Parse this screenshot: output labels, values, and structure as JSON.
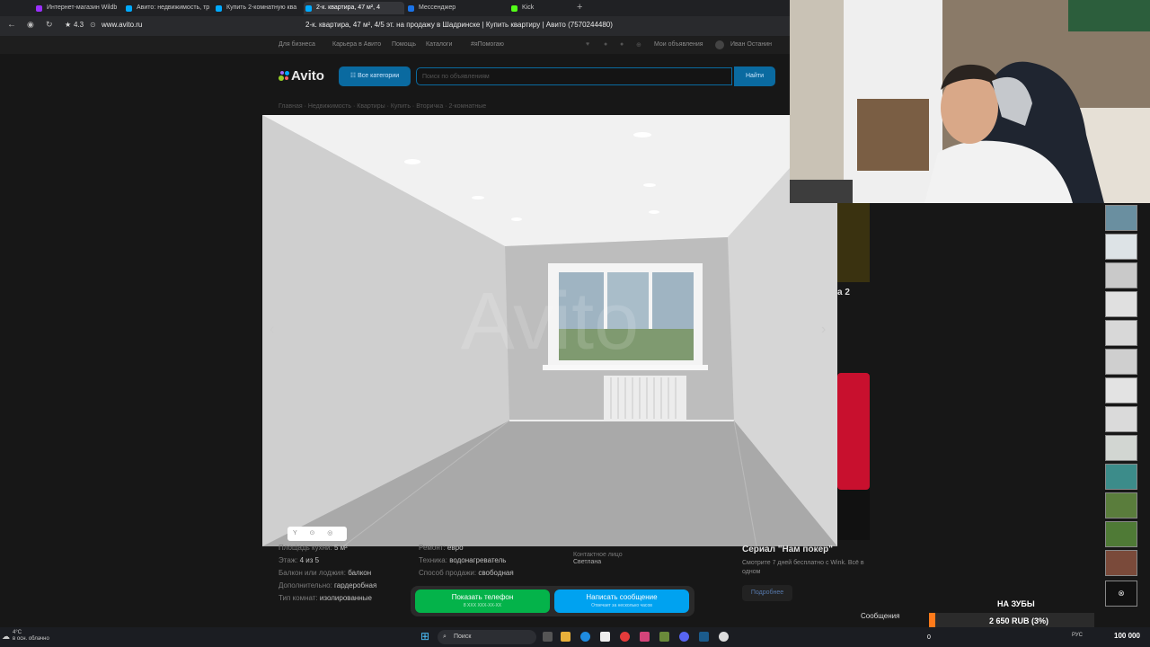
{
  "browser": {
    "tabs": [
      {
        "label": "Интернет-магазин Wildb",
        "color": "#9b30ff"
      },
      {
        "label": "Авито: недвижимость, тр",
        "color": "#00aaff"
      },
      {
        "label": "Купить 2-комнатную ква",
        "color": "#00aaff"
      },
      {
        "label": "2-к. квартира, 47 м², 4",
        "color": "#00aaff",
        "active": true
      },
      {
        "label": "Мессенджер",
        "color": "#1a73e8"
      },
      {
        "label": "Kick",
        "color": "#53fc18"
      }
    ],
    "rating": "4.3",
    "url": "www.avito.ru",
    "page_title": "2-к. квартира, 47 м², 4/5 эт. на продажу в Шадринске | Купить квартиру | Авито (7570244480)"
  },
  "topnav": {
    "links": [
      "Для бизнеса",
      "Карьера в Авито",
      "Помощь",
      "Каталоги",
      "#яПомогаю"
    ],
    "my_ads": "Мои объявления",
    "user": "Иван Останин"
  },
  "header": {
    "logo": "Avito",
    "categories_button": "Все категории",
    "search_placeholder": "Поиск по объявлениям",
    "find_button": "Найти"
  },
  "breadcrumbs": "Главная · Недвижимость · Квартиры · Купить · Вторичка · 2-комнатные",
  "photo": {
    "watermark": "Avito",
    "prev": "‹",
    "next": "›",
    "tools": "Y ⊙ ◎ ⋮"
  },
  "params": {
    "kitchen_label": "Площадь кухни:",
    "kitchen": "5 м²",
    "floor_label": "Этаж:",
    "floor": "4 из 5",
    "balcony_label": "Балкон или лоджия:",
    "balcony": "балкон",
    "extra_label": "Дополнительно:",
    "extra": "гардеробная",
    "rooms_label": "Тип комнат:",
    "rooms": "изолированные",
    "repair_label": "Ремонт:",
    "repair": "евро",
    "appliance_label": "Техника:",
    "appliance": "водонагреватель",
    "sale_label": "Способ продажи:",
    "sale": "свободная",
    "contact_label": "Контактное лицо",
    "contact": "Светлана"
  },
  "actions": {
    "phone": "Показать телефон",
    "phone_sub": "8 XXX XXX-XX-XX",
    "message": "Написать сообщение",
    "message_sub": "Отвечает за несколько часов"
  },
  "ad": {
    "text_fragment": "a 2",
    "title": "Сериал \"Нам покер\"",
    "subtitle": "Смотрите 7 дней бесплатно с Wink. Всё в одном",
    "more": "Подробнее"
  },
  "overlay": {
    "messages": "Сообщения",
    "goal_label": "НА ЗУБЫ",
    "goal_value": "2 650 RUB (3%)",
    "goal_progress": 0.03,
    "goal_min": "0",
    "goal_max": "100 000"
  },
  "taskbar": {
    "temp": "4°C",
    "weather": "в осн. облачно",
    "search": "Поиск",
    "lang": "РУС"
  }
}
